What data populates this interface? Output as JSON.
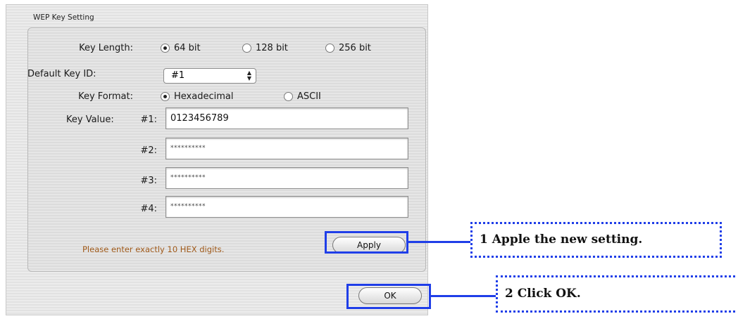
{
  "dialog": {
    "group_title": "WEP Key Setting",
    "key_length": {
      "label": "Key Length:",
      "options": [
        "64 bit",
        "128 bit",
        "256 bit"
      ],
      "selected": "64 bit"
    },
    "default_key_id": {
      "label": "Default Key ID:",
      "value": "#1"
    },
    "key_format": {
      "label": "Key Format:",
      "options": [
        "Hexadecimal",
        "ASCII"
      ],
      "selected": "Hexadecimal"
    },
    "key_value": {
      "label": "Key Value:",
      "keys": [
        {
          "label": "#1:",
          "value": "0123456789"
        },
        {
          "label": "#2:",
          "value": "**********"
        },
        {
          "label": "#3:",
          "value": "**********"
        },
        {
          "label": "#4:",
          "value": "**********"
        }
      ]
    },
    "hint": "Please enter exactly 10 HEX digits.",
    "apply_label": "Apply",
    "ok_label": "OK"
  },
  "annotations": {
    "callout_1": "1 Apple the new setting.",
    "callout_2": "2 Click OK.",
    "accent_color": "#1f3ee8"
  }
}
